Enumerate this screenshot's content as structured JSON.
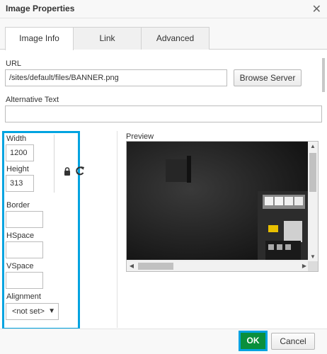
{
  "dialog": {
    "title": "Image Properties",
    "close_icon": "close-icon"
  },
  "tabs": [
    {
      "label": "Image Info",
      "active": true
    },
    {
      "label": "Link",
      "active": false
    },
    {
      "label": "Advanced",
      "active": false
    }
  ],
  "url": {
    "label": "URL",
    "value": "/sites/default/files/BANNER.png",
    "browse_label": "Browse Server"
  },
  "alt": {
    "label": "Alternative Text",
    "value": ""
  },
  "dims": {
    "width_label": "Width",
    "width_value": "1200",
    "height_label": "Height",
    "height_value": "313",
    "lock_icon": "lock-icon",
    "reset_icon": "reset-size-icon"
  },
  "border": {
    "label": "Border",
    "value": ""
  },
  "hspace": {
    "label": "HSpace",
    "value": ""
  },
  "vspace": {
    "label": "VSpace",
    "value": ""
  },
  "alignment": {
    "label": "Alignment",
    "selected": "<not set>"
  },
  "preview": {
    "label": "Preview"
  },
  "footer": {
    "ok_label": "OK",
    "cancel_label": "Cancel"
  },
  "colors": {
    "highlight": "#00a3e0",
    "ok_bg": "#0a8f3c"
  }
}
